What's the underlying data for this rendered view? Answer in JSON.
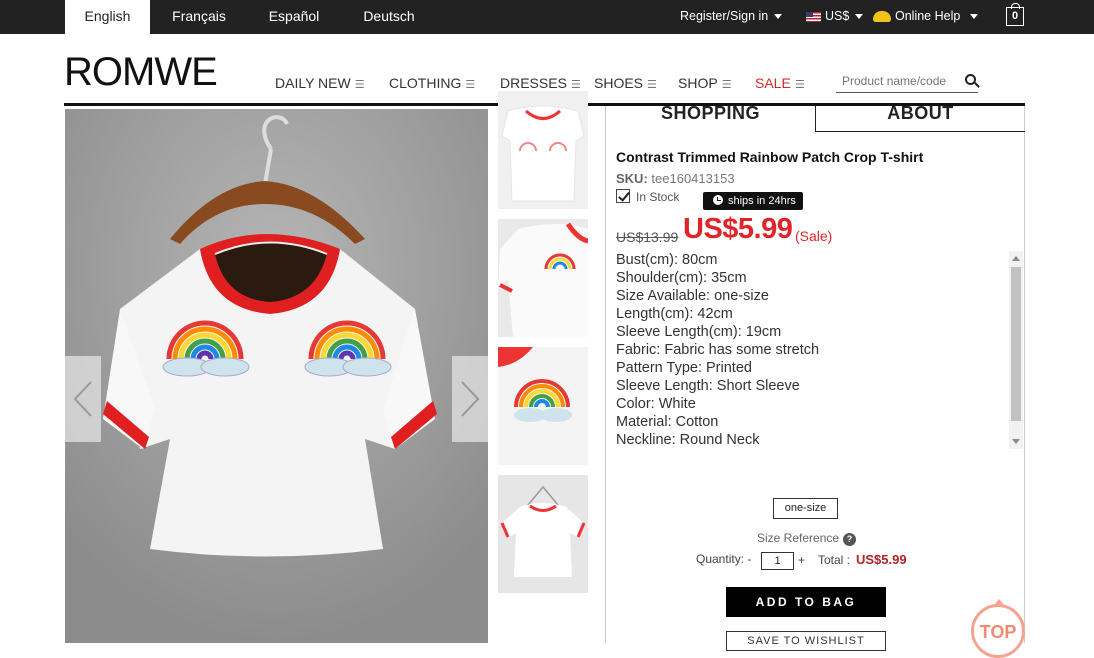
{
  "languages": [
    {
      "label": "English",
      "active": true
    },
    {
      "label": "Français"
    },
    {
      "label": "Español"
    },
    {
      "label": "Deutsch"
    }
  ],
  "topbar": {
    "register": "Register/Sign in",
    "currency": "US$",
    "help": "Online Help",
    "cart_count": "0"
  },
  "brand": "ROMWE",
  "nav": [
    "DAILY NEW",
    "CLOTHING",
    "DRESSES",
    "SHOES",
    "SHOP",
    "SALE"
  ],
  "search": {
    "placeholder": "Product name/code"
  },
  "tabs": [
    "SHOPPING",
    "ABOUT"
  ],
  "product": {
    "title": "Contrast Trimmed Rainbow Patch Crop T-shirt",
    "sku_label": "SKU:",
    "sku": "tee160413153",
    "stock": "In Stock",
    "ships": "ships in 24hrs",
    "old_price": "US$13.99",
    "price": "US$5.99",
    "sale_tag": "(Sale)",
    "specs": [
      "Bust(cm): 80cm",
      "Shoulder(cm): 35cm",
      "Size Available: one-size",
      "Length(cm): 42cm",
      "Sleeve Length(cm): 19cm",
      "Fabric: Fabric has some stretch",
      "Pattern Type: Printed",
      "Sleeve Length: Short Sleeve",
      "Color: White",
      "Material: Cotton",
      "Neckline: Round Neck"
    ],
    "size_option": "one-size",
    "size_reference": "Size Reference",
    "quantity_label": "Quantity:",
    "quantity": "1",
    "total_label": "Total :",
    "total": "US$5.99",
    "add_to_bag": "ADD TO BAG",
    "wishlist": "SAVE TO WISHLIST",
    "top_button": "TOP"
  }
}
